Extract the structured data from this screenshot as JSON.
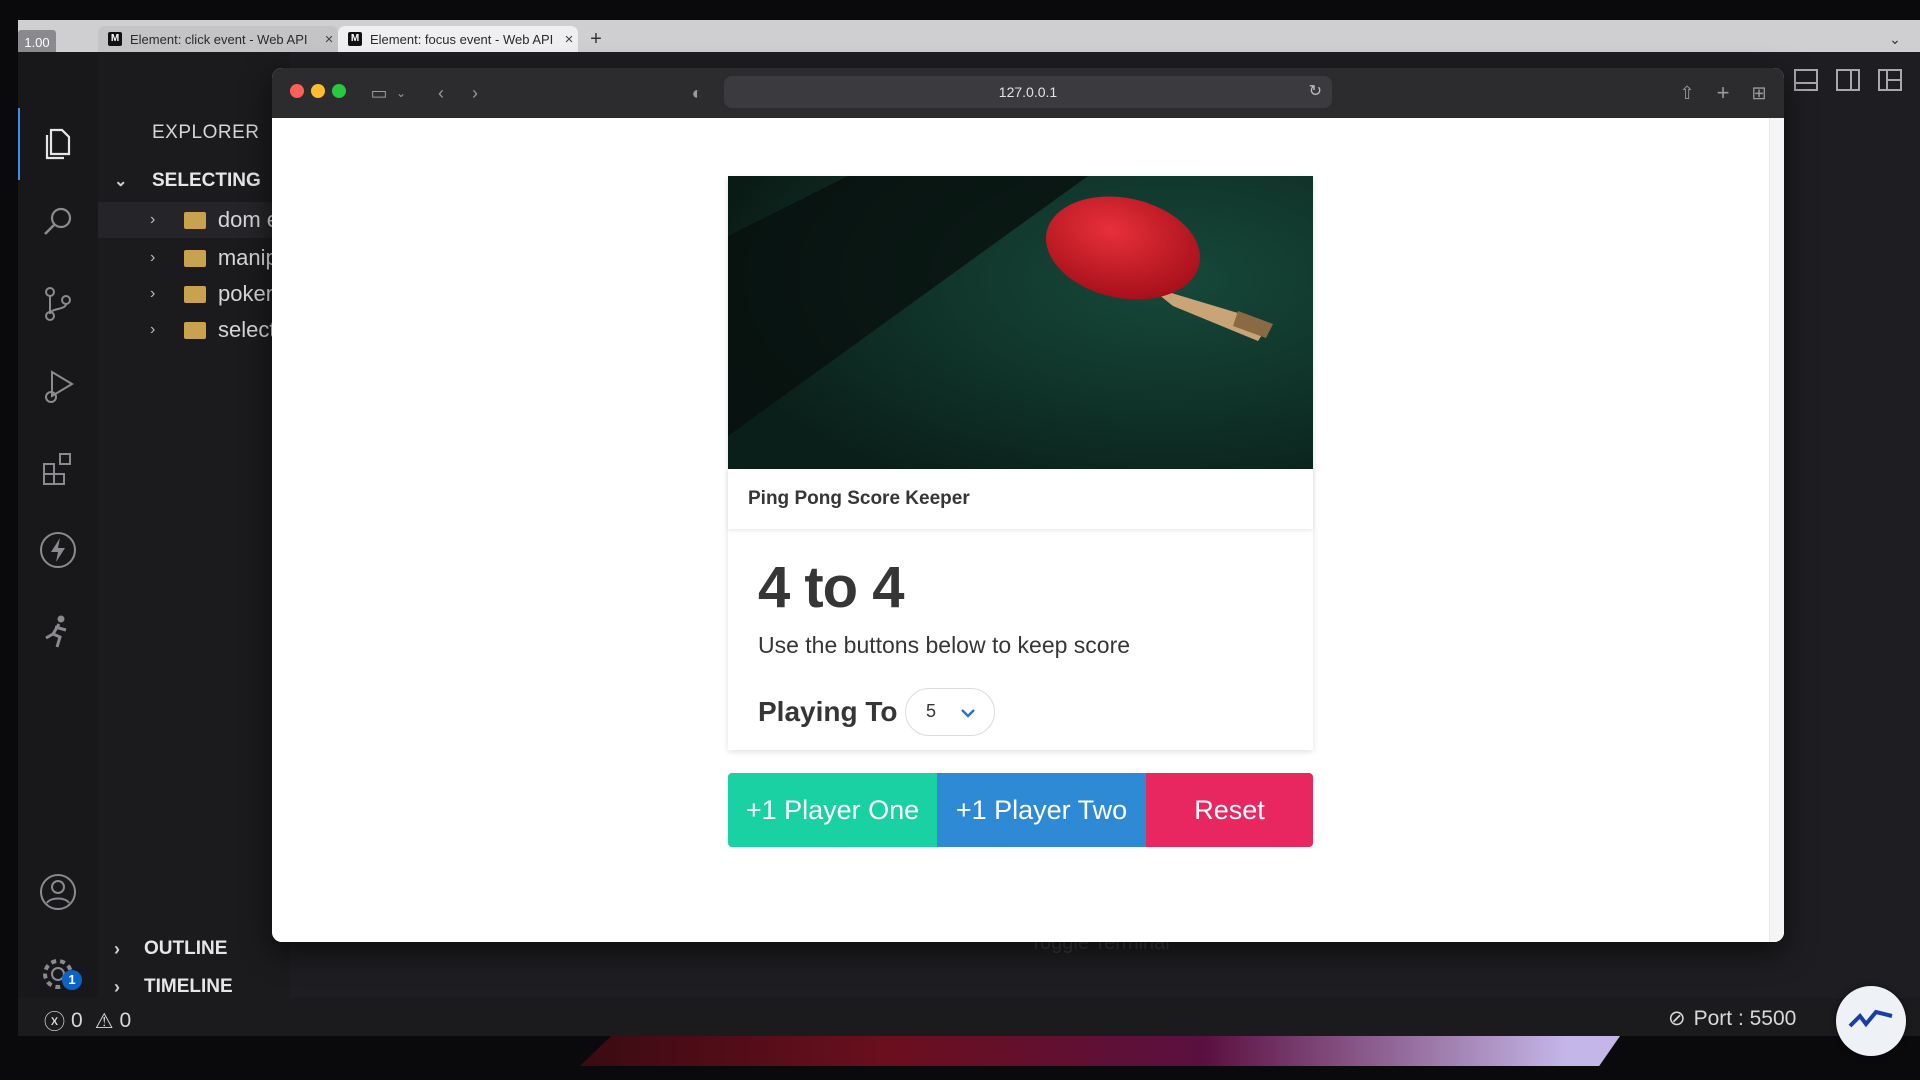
{
  "outer_browser": {
    "zoom": "1.00",
    "tabs": [
      {
        "label": "Element: click event - Web API",
        "favicon": "M"
      },
      {
        "label": "Element: focus event - Web API",
        "favicon": "M"
      }
    ]
  },
  "vscode": {
    "explorer_title": "EXPLORER",
    "section": "SELECTING",
    "folders": [
      "dom ev",
      "manipu",
      "pokem",
      "selecte"
    ],
    "outline_label": "OUTLINE",
    "timeline_label": "TIMELINE",
    "settings_badge": "1",
    "behind_text": "Toggle Terminal",
    "status": {
      "errors": "0",
      "warnings": "0",
      "port": "Port : 5500"
    }
  },
  "safari": {
    "url": "127.0.0.1"
  },
  "app": {
    "title": "Ping Pong Score Keeper",
    "score": "4 to 4",
    "subtitle": "Use the buttons below to keep score",
    "playing_to_label": "Playing To",
    "playing_to_value": "5",
    "buttons": {
      "p1": "+1 Player One",
      "p2": "+1 Player Two",
      "reset": "Reset"
    }
  },
  "colors": {
    "p1": "#19d1a2",
    "p2": "#2f8ad6",
    "reset": "#e8265f",
    "accent": "#3b8eea"
  }
}
